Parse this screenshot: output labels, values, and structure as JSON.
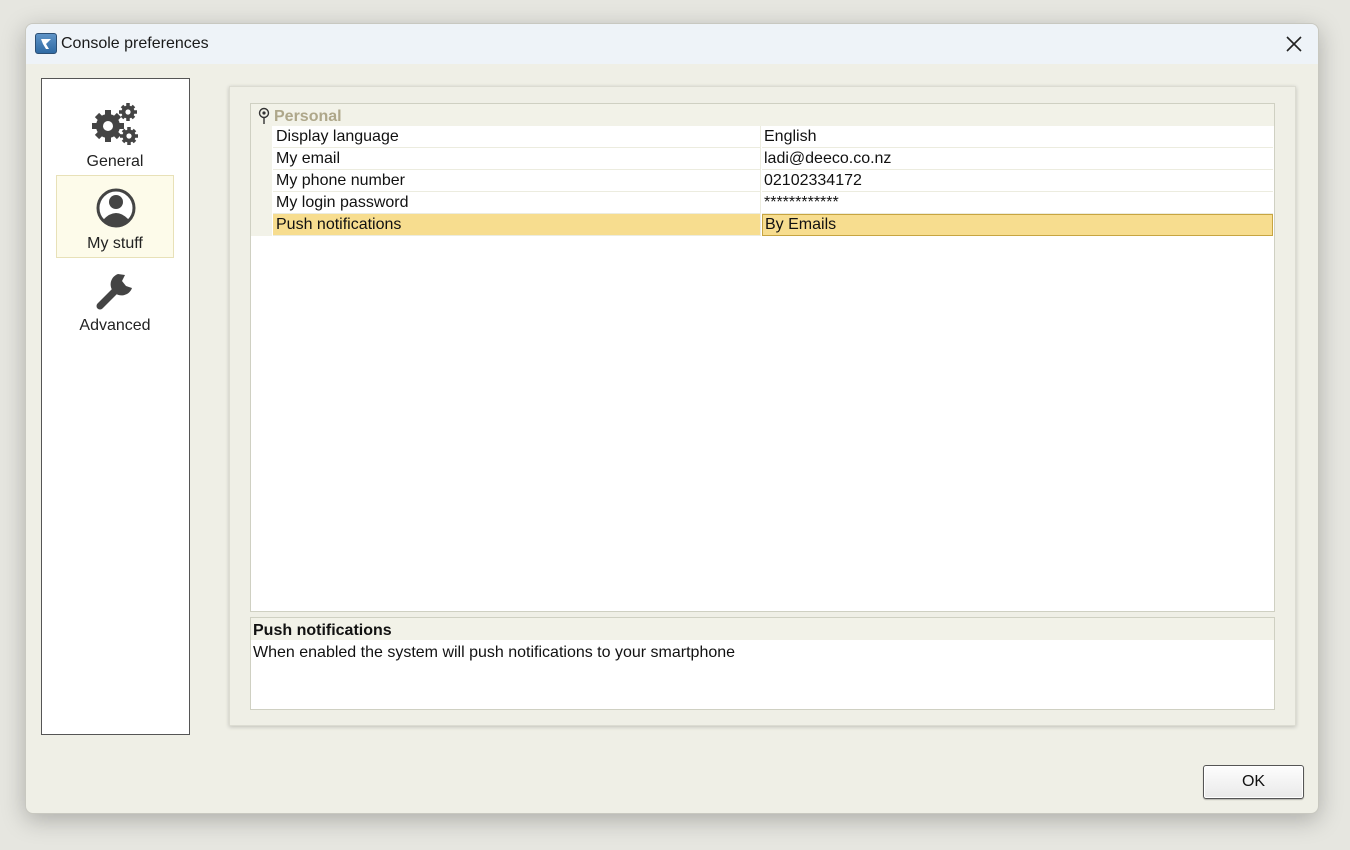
{
  "window": {
    "title": "Console preferences",
    "app_icon": "app-logo-icon",
    "close_icon": "close-icon"
  },
  "sidebar": {
    "items": [
      {
        "label": "General",
        "icon": "gears-icon",
        "selected": false
      },
      {
        "label": "My stuff",
        "icon": "user-icon",
        "selected": true
      },
      {
        "label": "Advanced",
        "icon": "wrench-icon",
        "selected": false
      }
    ]
  },
  "grid": {
    "category": "Personal",
    "category_icon": "pin-icon",
    "rows": [
      {
        "name": "Display language",
        "value": "English",
        "selected": false
      },
      {
        "name": "My email",
        "value": "ladi@deeco.co.nz",
        "selected": false
      },
      {
        "name": "My phone number",
        "value": "02102334172",
        "selected": false
      },
      {
        "name": "My login password",
        "value": "************",
        "selected": false
      },
      {
        "name": "Push notifications",
        "value": "By Emails",
        "selected": true
      }
    ]
  },
  "help": {
    "title": "Push notifications",
    "description": "When enabled the system will push notifications to your smartphone"
  },
  "footer": {
    "ok_label": "OK"
  },
  "colors": {
    "selection": "#f7dd8f",
    "category_text": "#aea78a",
    "window_bg": "#efefe6"
  }
}
